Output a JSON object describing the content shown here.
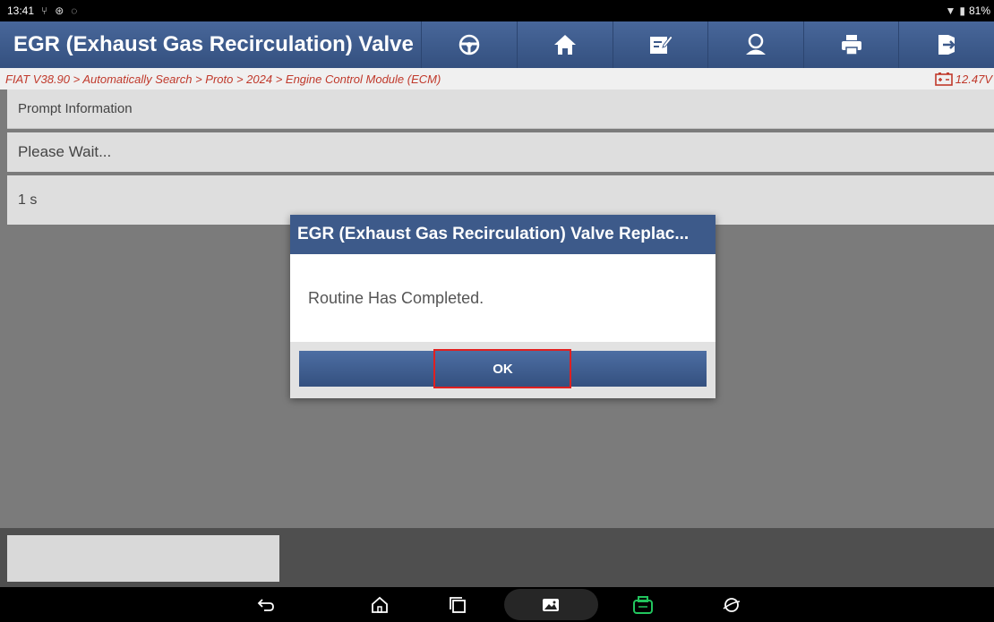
{
  "status_bar": {
    "time": "13:41",
    "battery": "81%"
  },
  "toolbar": {
    "title": "EGR (Exhaust Gas Recirculation) Valve",
    "buttons": [
      "steering-wheel-icon",
      "home-icon",
      "edit-icon",
      "user-icon",
      "print-icon",
      "exit-icon"
    ]
  },
  "breadcrumb": {
    "path": "FIAT V38.90 > Automatically Search > Proto > 2024 > Engine Control Module (ECM)",
    "voltage": "12.47V"
  },
  "content": {
    "header": "Prompt Information",
    "message": "Please Wait...",
    "timer": "1 s"
  },
  "dialog": {
    "title": "EGR (Exhaust Gas Recirculation) Valve Replac...",
    "message": "Routine Has Completed.",
    "ok_label": "OK"
  },
  "colors": {
    "header_blue": "#3d5a8a",
    "breadcrumb_red": "#c0392b",
    "vci_green": "#22c55e",
    "highlight_red": "#e02020"
  }
}
